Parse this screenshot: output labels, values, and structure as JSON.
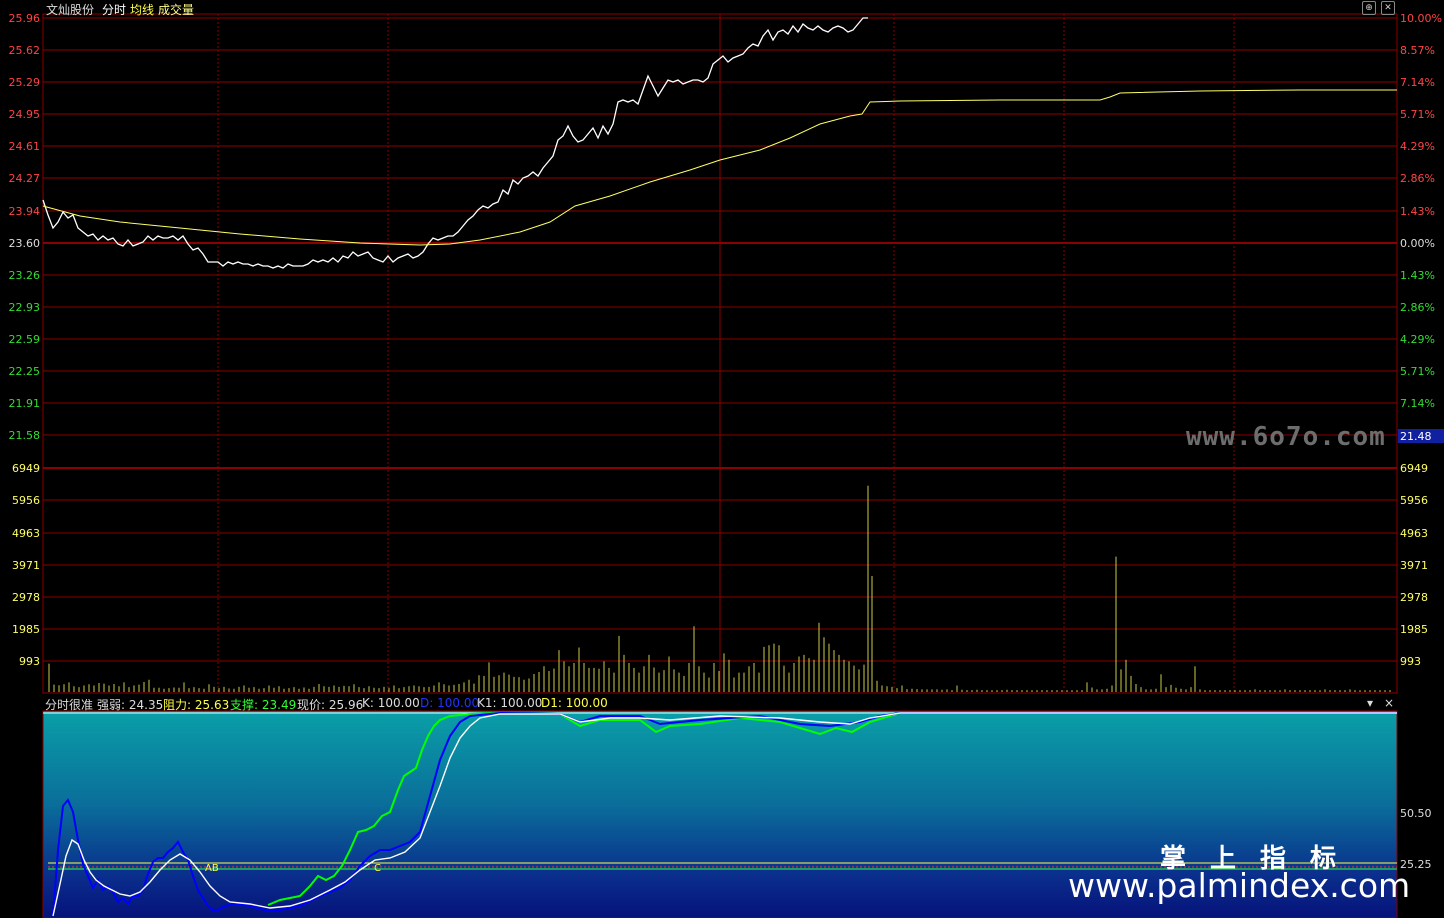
{
  "header": {
    "stock_name": "文灿股份",
    "tab_intraday": "分时",
    "tab_avg": "均线",
    "tab_volume": "成交量"
  },
  "price_axis": {
    "left_labels": [
      "25.96",
      "25.62",
      "25.29",
      "24.95",
      "24.61",
      "24.27",
      "23.94",
      "23.60",
      "23.26",
      "22.93",
      "22.59",
      "22.25",
      "21.91",
      "21.58"
    ],
    "right_labels": [
      "10.00%",
      "8.57%",
      "7.14%",
      "5.71%",
      "4.29%",
      "2.86%",
      "1.43%",
      "0.00%",
      "1.43%",
      "2.86%",
      "4.29%",
      "5.71%",
      "7.14%"
    ],
    "cursor_value": "21.48"
  },
  "volume_axis": {
    "labels": [
      "6949",
      "5956",
      "4963",
      "3971",
      "2978",
      "1985",
      "993"
    ]
  },
  "indicator": {
    "name": "分时很准",
    "strength_label": "强弱: 24.35",
    "resist_label": "阻力: 25.63",
    "support_label": "支撑: 23.49",
    "price_label": "现价: 25.96",
    "k_label": "K: 100.00",
    "d_label": "D: 100.00",
    "k1_label": "K1: 100.00",
    "d1_label": "D1: 100.00",
    "axis_labels": [
      "50.50",
      "25.25"
    ],
    "marker_ab": "AB",
    "marker_c": "C"
  },
  "watermarks": {
    "site1": "www.6o7o.com",
    "title": "掌上指标",
    "site2": "www.palmindex.com"
  },
  "colors": {
    "grid": "#8b0000",
    "price_line": "#ffffff",
    "avg_line": "#ffff66",
    "volume_bar": "#cccc44",
    "up_text": "#ff4444",
    "down_text": "#33dd33",
    "k_line": "#0000ff",
    "d_line": "#ffffff",
    "k1_line": "#00ff00"
  }
}
